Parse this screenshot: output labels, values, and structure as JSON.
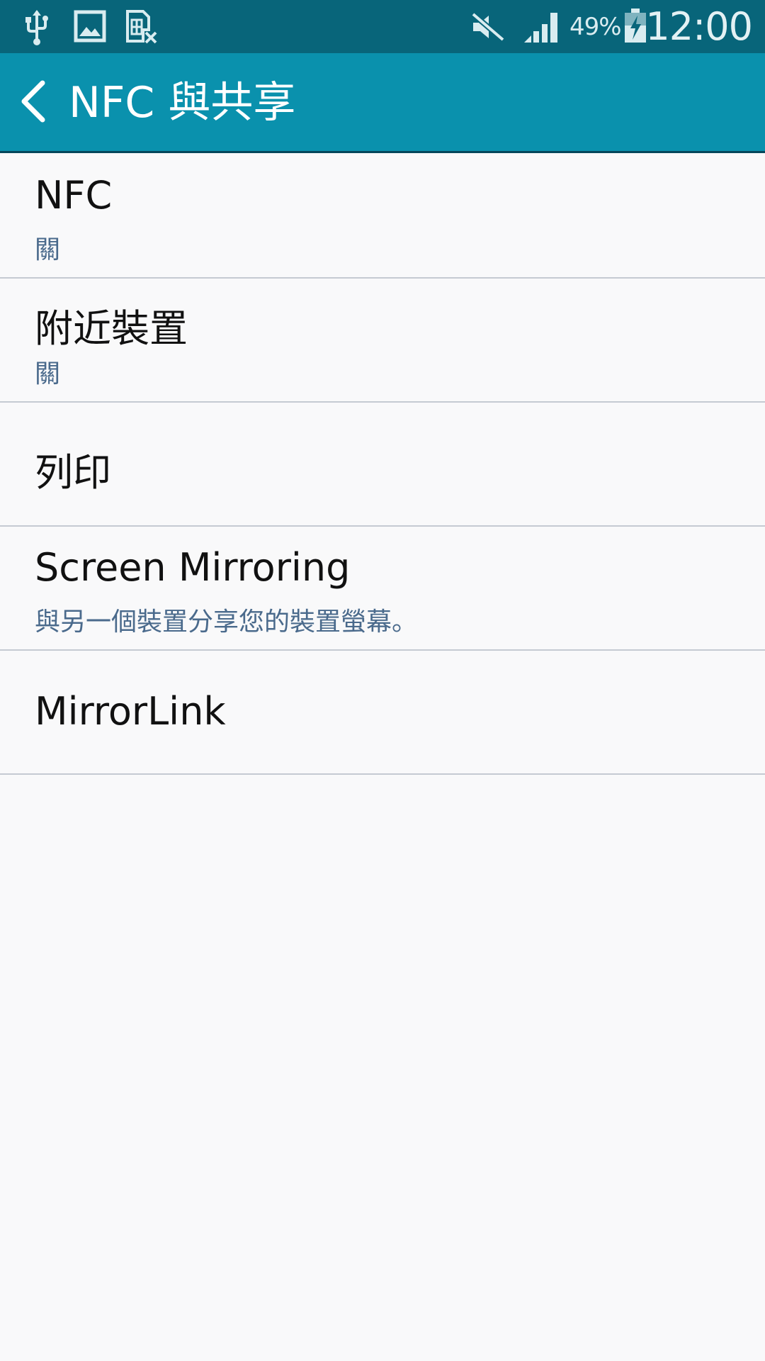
{
  "status_bar": {
    "icons_left": [
      "usb-icon",
      "image-icon",
      "sim-card-missing-icon"
    ],
    "icons_right": [
      "mute-icon",
      "signal-icon",
      "battery-charging-icon"
    ],
    "battery_percent": "49%",
    "clock": "12:00"
  },
  "action_bar": {
    "back_icon": "chevron-left-icon",
    "title": "NFC 與共享"
  },
  "settings_list": [
    {
      "title": "NFC",
      "summary": "關"
    },
    {
      "title": "附近裝置",
      "summary": "關"
    },
    {
      "title": "列印",
      "summary": ""
    },
    {
      "title": "Screen Mirroring",
      "summary": "與另一個裝置分享您的裝置螢幕。"
    },
    {
      "title": "MirrorLink",
      "summary": ""
    }
  ],
  "colors": {
    "status_bar": "#08657a",
    "action_bar": "#0a91ad",
    "background": "#f9f9fa",
    "summary_text": "#4a6a8c",
    "divider": "#c5cad2"
  }
}
